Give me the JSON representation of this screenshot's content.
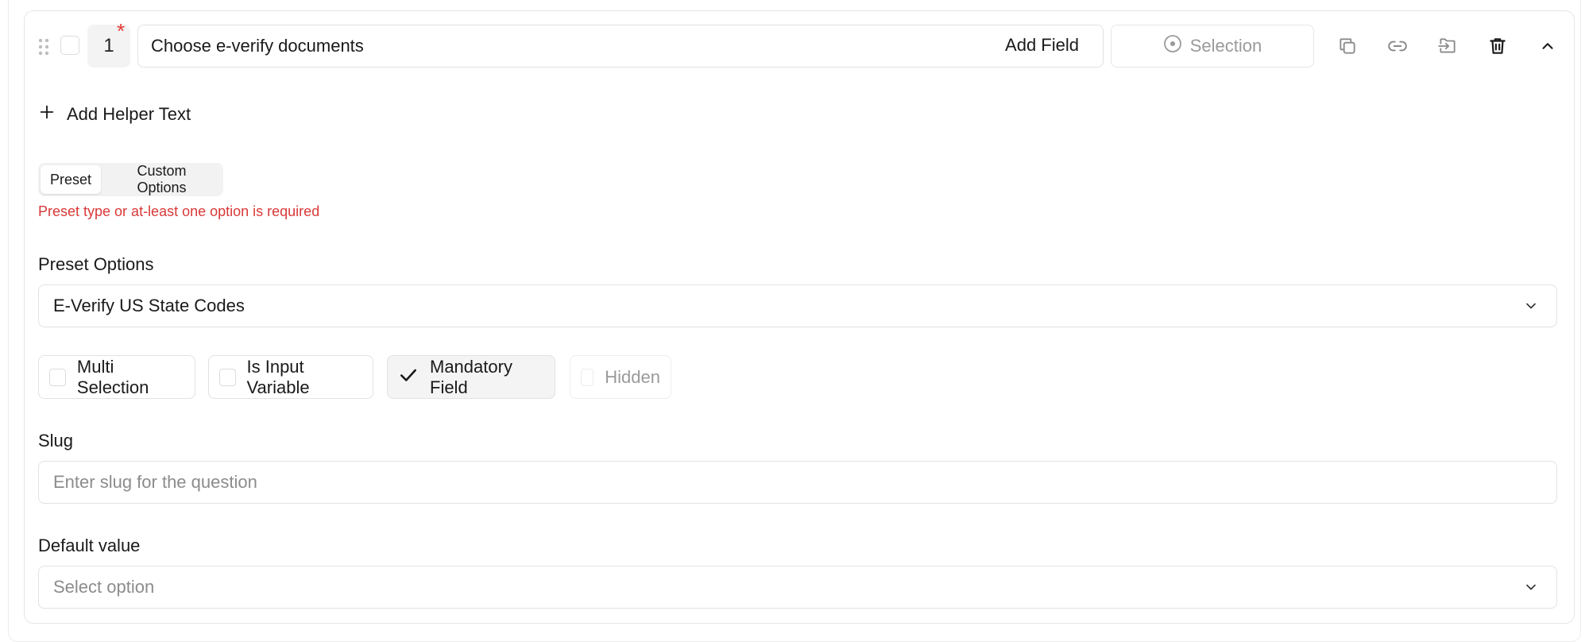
{
  "question": {
    "number": "1",
    "required_mark": "*",
    "text": "Choose e-verify documents",
    "add_field_label": "Add Field",
    "type_label": "Selection"
  },
  "helper": {
    "label": "Add Helper Text"
  },
  "mode": {
    "options": [
      "Preset",
      "Custom Options"
    ],
    "selected": "Preset",
    "error": "Preset type or at-least one option is required"
  },
  "preset": {
    "label": "Preset Options",
    "value": "E-Verify US State Codes"
  },
  "flags": [
    {
      "label": "Multi Selection",
      "checked": false,
      "disabled": false
    },
    {
      "label": "Is Input Variable",
      "checked": false,
      "disabled": false
    },
    {
      "label": "Mandatory Field",
      "checked": true,
      "disabled": false
    },
    {
      "label": "Hidden",
      "checked": false,
      "disabled": true
    }
  ],
  "slug": {
    "label": "Slug",
    "value": "",
    "placeholder": "Enter slug for the question"
  },
  "default_value": {
    "label": "Default value",
    "placeholder": "Select option"
  },
  "icons": [
    "drag-handle-icon",
    "selection-radio-icon",
    "duplicate-icon",
    "link-icon",
    "move-icon",
    "trash-icon",
    "chevron-up-icon",
    "plus-icon",
    "chevron-down-icon",
    "check-icon"
  ],
  "colors": {
    "error": "#d93838",
    "required": "#e53935",
    "border": "#e2e2e2"
  }
}
